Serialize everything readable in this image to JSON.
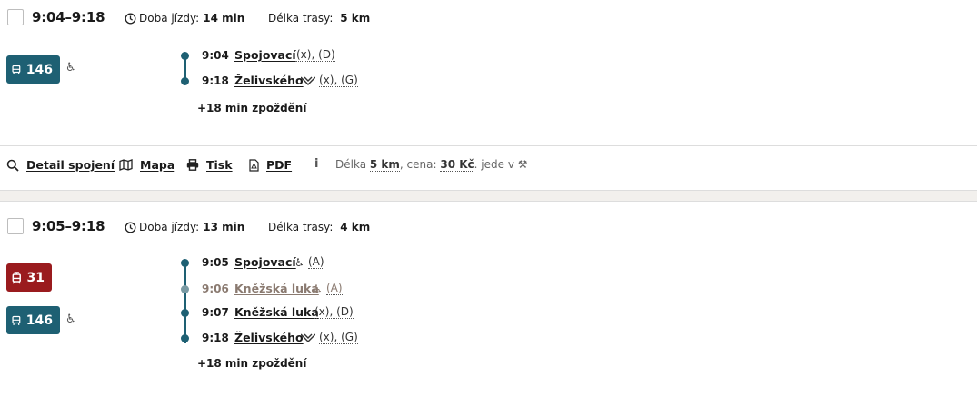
{
  "connections": [
    {
      "time_range": "9:04–9:18",
      "duration_label": "Doba jízdy:",
      "duration_value": "14 min",
      "distance_label": "Délka trasy:",
      "distance_value": "5 km",
      "lines": [
        {
          "type": "bus",
          "number": "146",
          "wheelchair": "♿"
        }
      ],
      "stops": [
        {
          "time": "9:04",
          "name": "Spojovací",
          "platform": "(x), (D)"
        },
        {
          "time": "9:18",
          "name": "Želivského",
          "platform": "(x), (G)",
          "metro": true
        }
      ],
      "delay": "+18 min zpoždění"
    },
    {
      "time_range": "9:05–9:18",
      "duration_label": "Doba jízdy:",
      "duration_value": "13 min",
      "distance_label": "Délka trasy:",
      "distance_value": "4 km",
      "lines": [
        {
          "type": "tram",
          "number": "31"
        },
        {
          "type": "bus",
          "number": "146",
          "wheelchair": "♿"
        }
      ],
      "stops": [
        {
          "time": "9:05",
          "name": "Spojovací",
          "platform": "(A)",
          "wheelchair": true
        },
        {
          "time": "9:06",
          "name": "Kněžská luka",
          "platform": "(A)",
          "wheelchair": true,
          "muted": true
        },
        {
          "time": "9:07",
          "name": "Kněžská luka",
          "platform": "(x), (D)"
        },
        {
          "time": "9:18",
          "name": "Želivského",
          "platform": "(x), (G)",
          "metro": true
        }
      ],
      "delay": "+18 min zpoždění"
    }
  ],
  "toolbar": {
    "detail_label": "Detail spojení",
    "map_label": "Mapa",
    "print_label": "Tisk",
    "pdf_label": "PDF",
    "info_icon": "i",
    "info_prefix": "Délka",
    "info_length": "5 km",
    "info_price_label": ", cena:",
    "info_price": "30 Kč",
    "info_suffix": ". jede v",
    "info_days_icon": "⚒"
  },
  "colors": {
    "bus": "#1e6073",
    "tram": "#9a1b1e",
    "muted_stop": "#8a7a70"
  }
}
